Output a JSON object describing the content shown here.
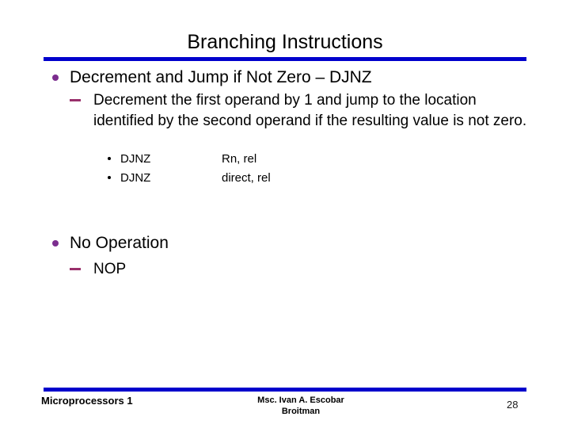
{
  "slide": {
    "title": "Branching Instructions",
    "accent_rule_color": "#0000CC",
    "bullet_level1_color": "#7B2D8E",
    "bullet_level2_color": "#99306B",
    "background_color": "#FFFFFF"
  },
  "content": {
    "section1": {
      "heading": "Decrement and Jump if Not Zero – DJNZ",
      "description": "Decrement the first operand by 1 and jump to the location identified by the second operand if the resulting value is not zero.",
      "instructions": [
        {
          "mnemonic": "DJNZ",
          "operands": "Rn, rel"
        },
        {
          "mnemonic": "DJNZ",
          "operands": "direct, rel"
        }
      ]
    },
    "section2": {
      "heading": "No Operation",
      "sub": "NOP"
    }
  },
  "footer": {
    "left": "Microprocessors 1",
    "center_line1": "Msc. Ivan A. Escobar",
    "center_line2": "Broitman",
    "page_number": "28"
  }
}
